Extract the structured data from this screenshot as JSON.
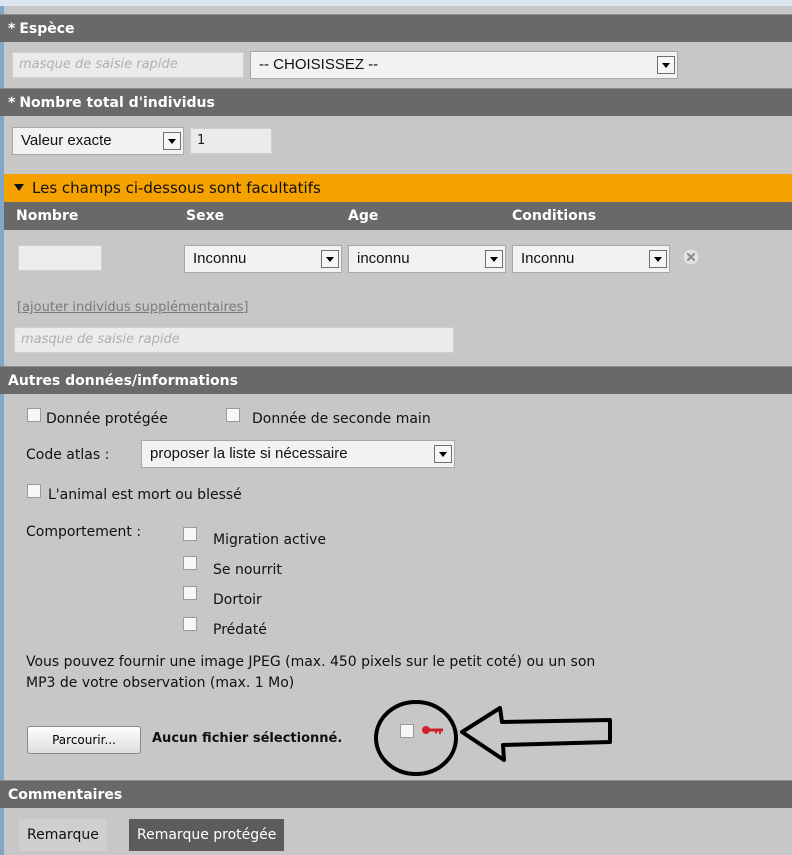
{
  "espece": {
    "header": "Espèce",
    "quick_mask_placeholder": "masque de saisie rapide",
    "select_value": "-- CHOISISSEZ --"
  },
  "total": {
    "header": "Nombre total d'individus",
    "mode_value": "Valeur exacte",
    "count_value": "1"
  },
  "optional": {
    "banner": "Les champs ci-dessous sont facultatifs",
    "columns": [
      "Nombre",
      "Sexe",
      "Age",
      "Conditions"
    ],
    "row": {
      "sexe": "Inconnu",
      "age": "inconnu",
      "conditions": "Inconnu"
    },
    "add_link": "[ajouter individus supplémentaires]",
    "quick_mask_placeholder": "masque de saisie rapide"
  },
  "autres": {
    "header": "Autres données/informations",
    "protected_label": "Donnée protégée",
    "second_hand_label": "Donnée de seconde main",
    "atlas_label": "Code atlas :",
    "atlas_value": "proposer la liste si nécessaire",
    "dead_label": "L'animal est mort ou blessé",
    "behaviour_label": "Comportement :",
    "behaviours": [
      "Migration active",
      "Se nourrit",
      "Dortoir",
      "Prédaté"
    ],
    "media_text_line1": "Vous pouvez fournir une image JPEG (max. 450 pixels sur le petit coté) ou un son",
    "media_text_line2": "MP3 de votre observation (max. 1 Mo)",
    "browse_label": "Parcourir...",
    "no_file_label": "Aucun fichier sélectionné."
  },
  "commentaires": {
    "header": "Commentaires",
    "tabs": [
      "Remarque",
      "Remarque protégée"
    ]
  },
  "colors": {
    "header_bg": "#696969",
    "panel_bg": "#c7c7c7",
    "banner_orange": "#f5a100",
    "annotation": "#000000",
    "key_red": "#d0202a"
  }
}
